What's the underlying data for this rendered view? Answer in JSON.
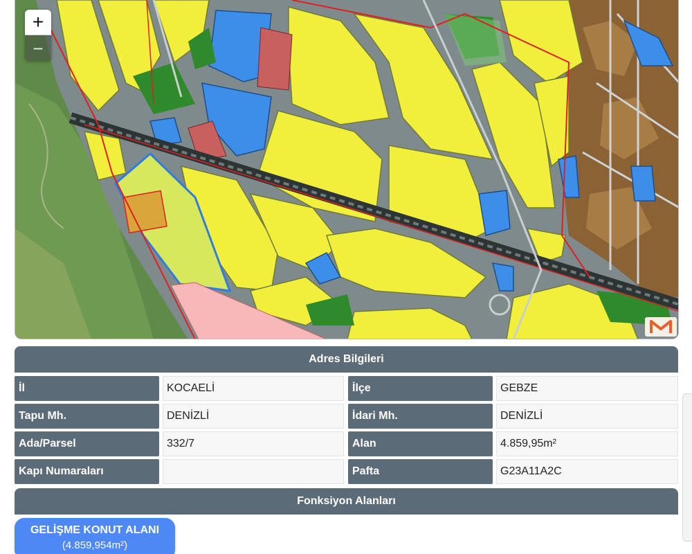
{
  "map": {
    "zoom_in_label": "+",
    "zoom_out_label": "−",
    "logo_icon": "m-brand-logo-icon",
    "colors": {
      "yellow": "#f2ef3c",
      "blue": "#3d8ee8",
      "brown": "#8a6233",
      "green": "#2f8a2c",
      "road": "#808a8c",
      "pink": "#f6b8b8",
      "boundary_red": "#e02020",
      "parcel_blue": "#2f7de0",
      "satellite": "#5f8a49"
    }
  },
  "address": {
    "title": "Adres Bilgileri",
    "rows": [
      {
        "label1": "İl",
        "value1": "KOCAELİ",
        "label2": "İlçe",
        "value2": "GEBZE"
      },
      {
        "label1": "Tapu Mh.",
        "value1": "DENİZLİ",
        "label2": "İdari Mh.",
        "value2": "DENİZLİ"
      },
      {
        "label1": "Ada/Parsel",
        "value1": "332/7",
        "label2": "Alan",
        "value2": "4.859,95m²"
      },
      {
        "label1": "Kapı Numaraları",
        "value1": "",
        "label2": "Pafta",
        "value2": "G23A11A2C"
      }
    ]
  },
  "functions": {
    "title": "Fonksiyon Alanları",
    "items": [
      {
        "name": "GELİŞME KONUT ALANI",
        "area": "(4.859,954m²)"
      }
    ]
  }
}
